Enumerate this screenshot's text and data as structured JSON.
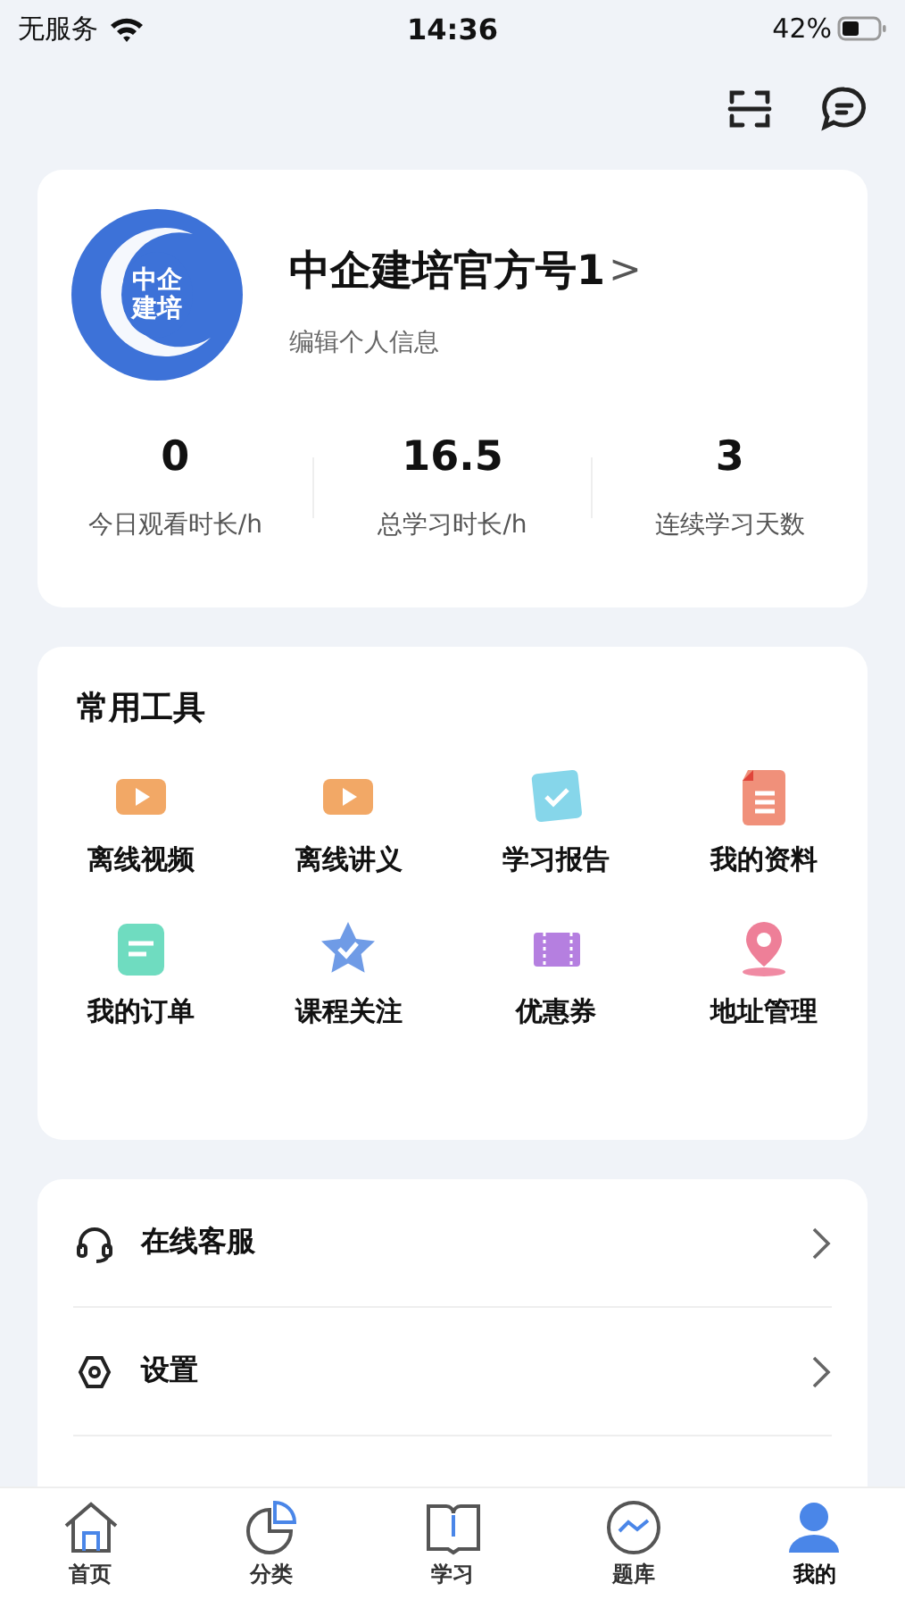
{
  "status_bar": {
    "carrier": "无服务",
    "time": "14:36",
    "battery": "42%"
  },
  "profile": {
    "logo_text": [
      "中企",
      "建培"
    ],
    "name": "中企建培官方号1",
    "chevron": ">",
    "subtitle": "编辑个人信息",
    "stats": [
      {
        "value": "0",
        "label": "今日观看时长/h"
      },
      {
        "value": "16.5",
        "label": "总学习时长/h"
      },
      {
        "value": "3",
        "label": "连续学习天数"
      }
    ]
  },
  "tools": {
    "title": "常用工具",
    "items": [
      {
        "kind": "video",
        "label": "离线视频"
      },
      {
        "kind": "handout",
        "label": "离线讲义"
      },
      {
        "kind": "report",
        "label": "学习报告"
      },
      {
        "kind": "docs",
        "label": "我的资料"
      },
      {
        "kind": "order",
        "label": "我的订单"
      },
      {
        "kind": "follow",
        "label": "课程关注"
      },
      {
        "kind": "coupon",
        "label": "优惠券"
      },
      {
        "kind": "address",
        "label": "地址管理"
      }
    ]
  },
  "menu": [
    {
      "kind": "service",
      "label": "在线客服"
    },
    {
      "kind": "settings",
      "label": "设置"
    }
  ],
  "tab_bar": [
    {
      "kind": "home",
      "label": "首页",
      "selected": false
    },
    {
      "kind": "category",
      "label": "分类",
      "selected": false
    },
    {
      "kind": "study",
      "label": "学习",
      "selected": false
    },
    {
      "kind": "quiz",
      "label": "题库",
      "selected": false
    },
    {
      "kind": "mine",
      "label": "我的",
      "selected": true
    }
  ]
}
